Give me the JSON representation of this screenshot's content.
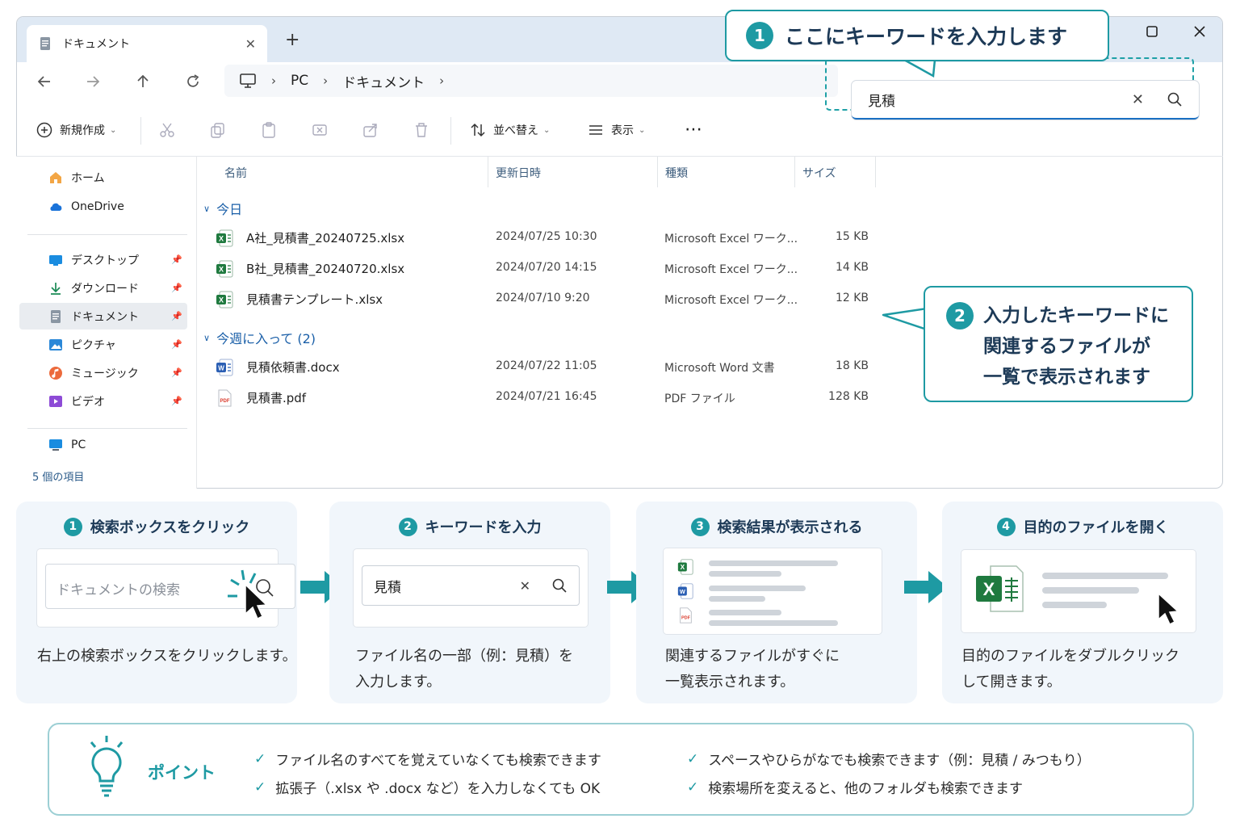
{
  "window": {
    "tab_title": "ドキュメント",
    "new_tab": "+",
    "address": {
      "crumbs": [
        "PC",
        "ドキュメント"
      ]
    },
    "search": {
      "value": "見積"
    }
  },
  "toolbar": {
    "new": "新規作成",
    "sort": "並べ替え",
    "view": "表示"
  },
  "sidebar": {
    "items": [
      {
        "label": "ホーム",
        "icon": "home-icon"
      },
      {
        "label": "OneDrive",
        "icon": "cloud-icon"
      },
      {
        "label": "デスクトップ",
        "icon": "desktop-icon"
      },
      {
        "label": "ダウンロード",
        "icon": "download-icon"
      },
      {
        "label": "ドキュメント",
        "icon": "document-icon"
      },
      {
        "label": "ピクチャ",
        "icon": "picture-icon"
      },
      {
        "label": "ミュージック",
        "icon": "music-icon"
      },
      {
        "label": "ビデオ",
        "icon": "video-icon"
      },
      {
        "label": "PC",
        "icon": "pc-icon"
      }
    ],
    "status": "5 個の項目"
  },
  "columns": {
    "name": "名前",
    "modified": "更新日時",
    "type": "種類",
    "size": "サイズ"
  },
  "groups": [
    {
      "label": "今日",
      "files": [
        {
          "name": "A社_見積書_20240725.xlsx",
          "date": "2024/07/25 10:30",
          "type": "Microsoft Excel ワーク...",
          "size": "15 KB",
          "icon": "excel-file-icon"
        },
        {
          "name": "B社_見積書_20240720.xlsx",
          "date": "2024/07/20 14:15",
          "type": "Microsoft Excel ワーク...",
          "size": "14 KB",
          "icon": "excel-file-icon"
        },
        {
          "name": "見積書テンプレート.xlsx",
          "date": "2024/07/10 9:20",
          "type": "Microsoft Excel ワーク...",
          "size": "12 KB",
          "icon": "excel-file-icon"
        }
      ]
    },
    {
      "label": "今週に入って (2)",
      "files": [
        {
          "name": "見積依頼書.docx",
          "date": "2024/07/22 11:05",
          "type": "Microsoft Word 文書",
          "size": "18 KB",
          "icon": "word-file-icon"
        },
        {
          "name": "見積書.pdf",
          "date": "2024/07/21 16:45",
          "type": "PDF ファイル",
          "size": "128 KB",
          "icon": "pdf-file-icon"
        }
      ]
    }
  ],
  "callout1": {
    "num": "1",
    "text": "ここにキーワードを入力します"
  },
  "callout2": {
    "num": "2",
    "lines": [
      "入力したキーワードに",
      "関連するファイルが",
      "一覧で表示されます"
    ]
  },
  "steps": [
    {
      "num": "1",
      "title": "検索ボックスをクリック",
      "placeholder": "ドキュメントの検索",
      "desc": [
        "右上の検索ボックスをクリックします。"
      ]
    },
    {
      "num": "2",
      "title": "キーワードを入力",
      "value": "見積",
      "desc": [
        "ファイル名の一部（例：見積）を",
        "入力します。"
      ]
    },
    {
      "num": "3",
      "title": "検索結果が表示される",
      "desc": [
        "関連するファイルがすぐに",
        "一覧表示されます。"
      ]
    },
    {
      "num": "4",
      "title": "目的のファイルを開く",
      "desc": [
        "目的のファイルをダブルクリック",
        "して開きます。"
      ]
    }
  ],
  "point": {
    "title": "ポイント",
    "items": [
      "ファイル名のすべてを覚えていなくても検索できます",
      "拡張子（.xlsx や .docx など）を入力しなくても OK",
      "スペースやひらがなでも検索できます（例：見積 / みつもり）",
      "検索場所を変えると、他のフォルダも検索できます"
    ]
  },
  "colors": {
    "accent": "#1e9aa3",
    "link": "#1a5fa8",
    "excel": "#1f7a3f",
    "word": "#2b5fb4",
    "pdf": "#d93a2b"
  }
}
